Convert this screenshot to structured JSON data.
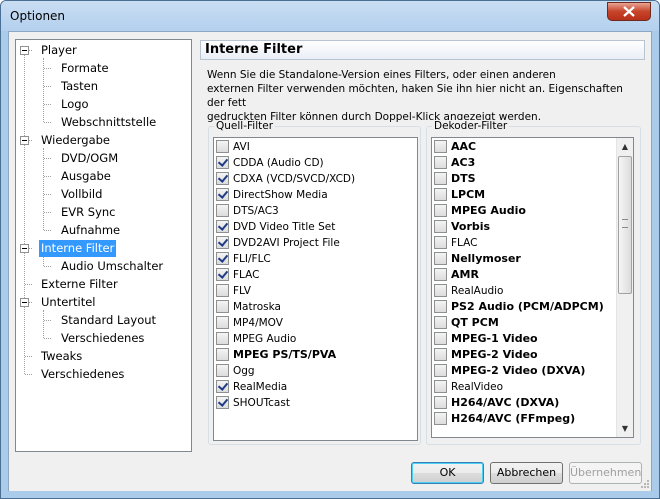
{
  "window": {
    "title": "Optionen"
  },
  "tree": [
    {
      "label": "Player",
      "level": 0,
      "expander": true
    },
    {
      "label": "Formate",
      "level": 1
    },
    {
      "label": "Tasten",
      "level": 1
    },
    {
      "label": "Logo",
      "level": 1
    },
    {
      "label": "Webschnittstelle",
      "level": 1
    },
    {
      "label": "Wiedergabe",
      "level": 0,
      "expander": true
    },
    {
      "label": "DVD/OGM",
      "level": 1
    },
    {
      "label": "Ausgabe",
      "level": 1
    },
    {
      "label": "Vollbild",
      "level": 1
    },
    {
      "label": "EVR Sync",
      "level": 1
    },
    {
      "label": "Aufnahme",
      "level": 1
    },
    {
      "label": "Interne Filter",
      "level": 0,
      "expander": true,
      "selected": true
    },
    {
      "label": "Audio Umschalter",
      "level": 1
    },
    {
      "label": "Externe Filter",
      "level": 0
    },
    {
      "label": "Untertitel",
      "level": 0,
      "expander": true
    },
    {
      "label": "Standard Layout",
      "level": 1
    },
    {
      "label": "Verschiedenes",
      "level": 1
    },
    {
      "label": "Tweaks",
      "level": 0
    },
    {
      "label": "Verschiedenes",
      "level": 0
    }
  ],
  "panel": {
    "title": "Interne Filter",
    "description": [
      "Wenn Sie die Standalone-Version eines Filters, oder einen anderen",
      "externen Filter verwenden möchten, haken Sie ihn hier nicht an. Eigenschaften der fett",
      "gedruckten Filter können durch Doppel-Klick angezeigt werden."
    ]
  },
  "source_filters": {
    "label": "Quell-Filter",
    "items": [
      {
        "label": "AVI",
        "checked": false,
        "bold": false
      },
      {
        "label": "CDDA (Audio CD)",
        "checked": true,
        "bold": false
      },
      {
        "label": "CDXA (VCD/SVCD/XCD)",
        "checked": true,
        "bold": false
      },
      {
        "label": "DirectShow Media",
        "checked": true,
        "bold": false
      },
      {
        "label": "DTS/AC3",
        "checked": false,
        "bold": false
      },
      {
        "label": "DVD Video Title Set",
        "checked": true,
        "bold": false
      },
      {
        "label": "DVD2AVI Project File",
        "checked": true,
        "bold": false
      },
      {
        "label": "FLI/FLC",
        "checked": true,
        "bold": false
      },
      {
        "label": "FLAC",
        "checked": true,
        "bold": false
      },
      {
        "label": "FLV",
        "checked": false,
        "bold": false
      },
      {
        "label": "Matroska",
        "checked": false,
        "bold": false
      },
      {
        "label": "MP4/MOV",
        "checked": false,
        "bold": false
      },
      {
        "label": "MPEG Audio",
        "checked": false,
        "bold": false
      },
      {
        "label": "MPEG PS/TS/PVA",
        "checked": false,
        "bold": true
      },
      {
        "label": "Ogg",
        "checked": false,
        "bold": false
      },
      {
        "label": "RealMedia",
        "checked": true,
        "bold": false
      },
      {
        "label": "SHOUTcast",
        "checked": true,
        "bold": false
      }
    ]
  },
  "decoder_filters": {
    "label": "Dekoder-Filter",
    "items": [
      {
        "label": "AAC",
        "checked": false,
        "bold": true
      },
      {
        "label": "AC3",
        "checked": false,
        "bold": true
      },
      {
        "label": "DTS",
        "checked": false,
        "bold": true
      },
      {
        "label": "LPCM",
        "checked": false,
        "bold": true
      },
      {
        "label": "MPEG Audio",
        "checked": false,
        "bold": true
      },
      {
        "label": "Vorbis",
        "checked": false,
        "bold": true
      },
      {
        "label": "FLAC",
        "checked": false,
        "bold": false
      },
      {
        "label": "Nellymoser",
        "checked": false,
        "bold": true
      },
      {
        "label": "AMR",
        "checked": false,
        "bold": true
      },
      {
        "label": "RealAudio",
        "checked": false,
        "bold": false
      },
      {
        "label": "PS2 Audio (PCM/ADPCM)",
        "checked": false,
        "bold": true
      },
      {
        "label": "QT PCM",
        "checked": false,
        "bold": true
      },
      {
        "label": "MPEG-1 Video",
        "checked": false,
        "bold": true
      },
      {
        "label": "MPEG-2 Video",
        "checked": false,
        "bold": true
      },
      {
        "label": "MPEG-2 Video (DXVA)",
        "checked": false,
        "bold": true
      },
      {
        "label": "RealVideo",
        "checked": false,
        "bold": false
      },
      {
        "label": "H264/AVC (DXVA)",
        "checked": false,
        "bold": true
      },
      {
        "label": "H264/AVC (FFmpeg)",
        "checked": false,
        "bold": true
      }
    ]
  },
  "buttons": {
    "ok": "OK",
    "cancel": "Abbrechen",
    "apply": "Übernehmen"
  }
}
